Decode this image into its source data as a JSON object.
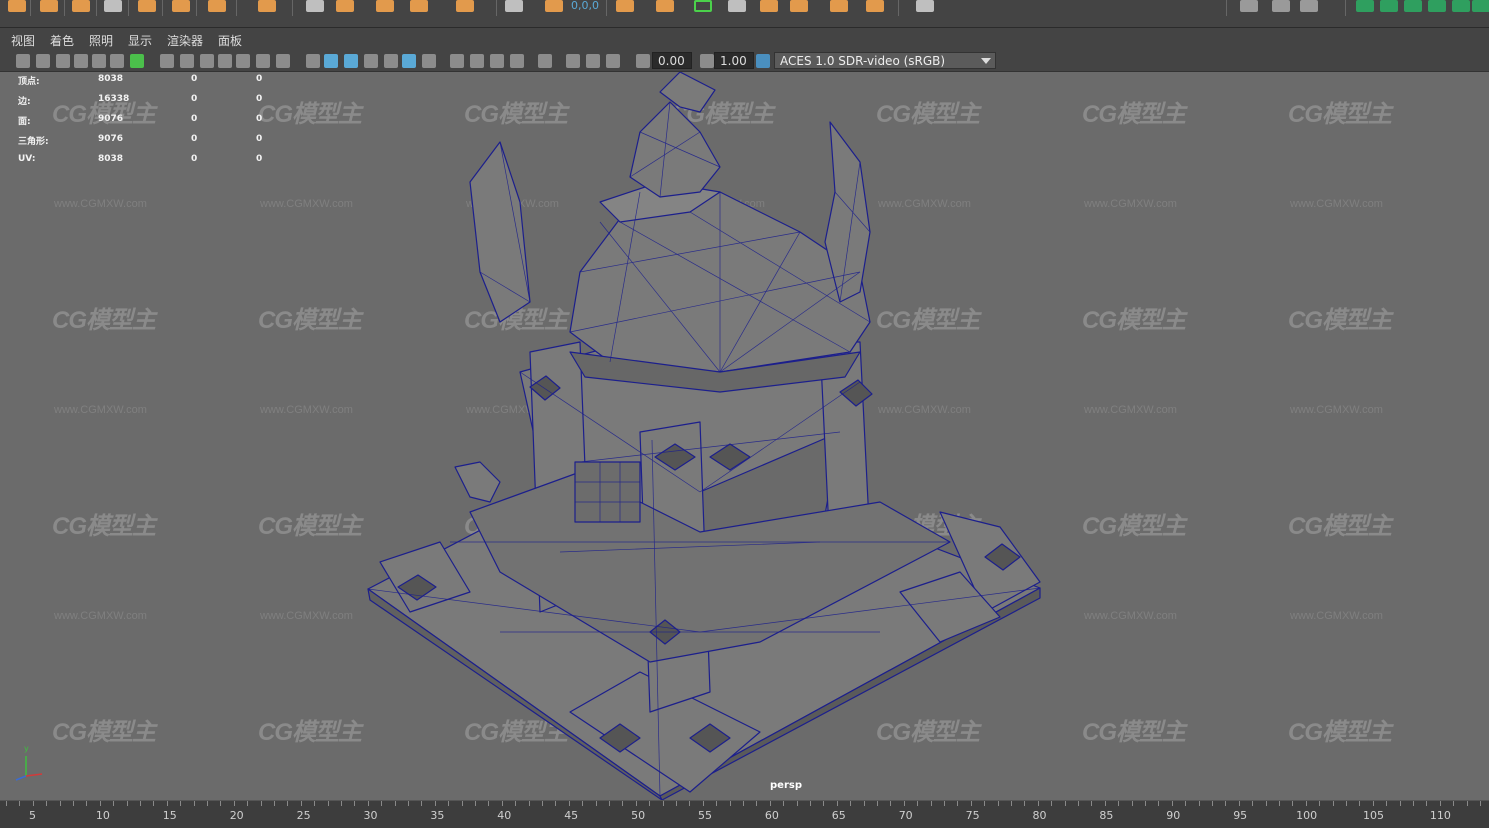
{
  "shelf": {
    "icons": [
      "cube-icon",
      "sphere-icon",
      "cylinder-icon",
      "cone-icon",
      "torus-icon",
      "plane-icon",
      "pipe-icon",
      "extrude-icon",
      "bevel-icon",
      "bridge-icon",
      "append-icon",
      "grid-icon",
      "soft-select-icon",
      "move-icon",
      "rotate-icon",
      "scale-icon",
      "uv-icon",
      "sculpt-icon",
      "snap-icon",
      "camera-icon",
      "render-icon",
      "light-icon",
      "material-icon",
      "deform-icon"
    ],
    "readout": "0,0,0",
    "accent": "#e29a4c"
  },
  "menu": {
    "items": [
      "视图",
      "着色",
      "照明",
      "显示",
      "渲染器",
      "面板"
    ]
  },
  "toolbar": {
    "exposure_value": "0.00",
    "gamma_value": "1.00",
    "color_space": "ACES 1.0 SDR-video (sRGB)",
    "highlight_color": "#5aa9d6"
  },
  "hud": {
    "rows": [
      {
        "label": "顶点:",
        "total": "8038",
        "sel": "0",
        "extra": "0"
      },
      {
        "label": "边:",
        "total": "16338",
        "sel": "0",
        "extra": "0"
      },
      {
        "label": "面:",
        "total": "9076",
        "sel": "0",
        "extra": "0"
      },
      {
        "label": "三角形:",
        "total": "9076",
        "sel": "0",
        "extra": "0"
      },
      {
        "label": "UV:",
        "total": "8038",
        "sel": "0",
        "extra": "0"
      }
    ]
  },
  "watermark": {
    "logo_text": "CG模型主",
    "url_text": "www.CGMXW.com"
  },
  "viewport": {
    "camera": "persp",
    "wire_color": "#1c1f8c",
    "mesh_color": "#7a7a7a",
    "background": "#6b6b6b"
  },
  "axis": {
    "y_label": "y",
    "x_color": "#d23a3a",
    "y_color": "#3fbf3f",
    "z_color": "#3a6cd2"
  },
  "timeline": {
    "ticks": [
      "5",
      "10",
      "15",
      "20",
      "25",
      "30",
      "35",
      "40",
      "45",
      "50",
      "55",
      "60",
      "65",
      "70",
      "75",
      "80",
      "85",
      "90",
      "95",
      "100",
      "105",
      "110"
    ]
  }
}
